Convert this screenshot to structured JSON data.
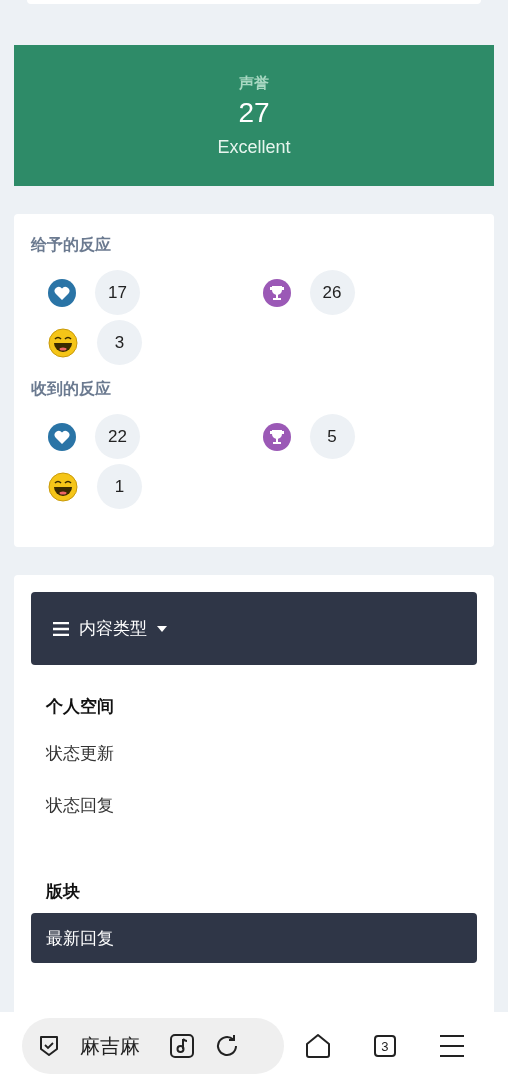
{
  "reputation": {
    "label": "声誉",
    "value": "27",
    "rating": "Excellent"
  },
  "reactions": [
    {
      "title": "给予的反应",
      "items": [
        {
          "kind": "like",
          "count": "17"
        },
        {
          "kind": "trophy",
          "count": "26"
        },
        {
          "kind": "laugh",
          "count": "3"
        }
      ]
    },
    {
      "title": "收到的反应",
      "items": [
        {
          "kind": "like",
          "count": "22"
        },
        {
          "kind": "trophy",
          "count": "5"
        },
        {
          "kind": "laugh",
          "count": "1"
        }
      ]
    }
  ],
  "content_menu": {
    "title": "内容类型",
    "sections": [
      {
        "heading": "个人空间",
        "items": [
          {
            "label": "状态更新",
            "selected": false
          },
          {
            "label": "状态回复",
            "selected": false
          }
        ]
      },
      {
        "heading": "版块",
        "items": [
          {
            "label": "最新回复",
            "selected": true
          }
        ]
      }
    ]
  },
  "browser_bar": {
    "address": "麻吉麻",
    "tab_count": "3"
  }
}
